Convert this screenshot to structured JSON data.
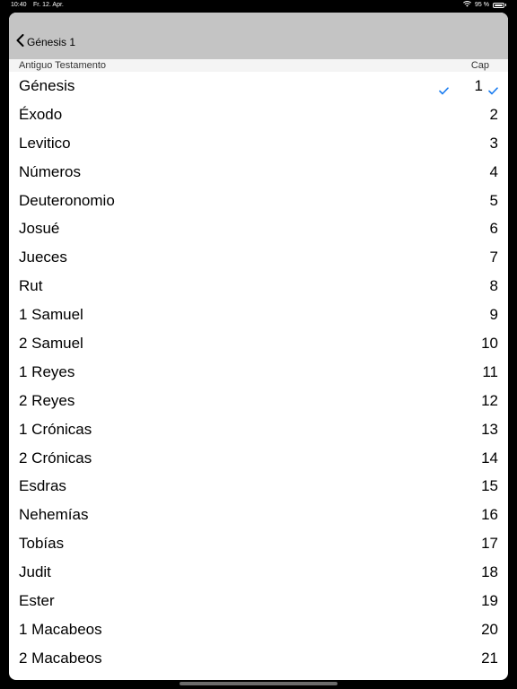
{
  "status": {
    "time": "10:40",
    "date": "Fr. 12. Apr.",
    "battery": "95 %",
    "battery_level": 0.95
  },
  "nav": {
    "back_label": "Génesis 1"
  },
  "section": {
    "title": "Antiguo Testamento",
    "column": "Cap"
  },
  "colors": {
    "accent": "#1a7cf0",
    "navbar": "#c4c4c4"
  },
  "rows": [
    {
      "book": "Génesis",
      "chapter": "1",
      "selected": true
    },
    {
      "book": "Éxodo",
      "chapter": "2"
    },
    {
      "book": "Levitico",
      "chapter": "3"
    },
    {
      "book": "Números",
      "chapter": "4"
    },
    {
      "book": "Deuteronomio",
      "chapter": "5"
    },
    {
      "book": "Josué",
      "chapter": "6"
    },
    {
      "book": "Jueces",
      "chapter": "7"
    },
    {
      "book": "Rut",
      "chapter": "8"
    },
    {
      "book": "1 Samuel",
      "chapter": "9"
    },
    {
      "book": "2 Samuel",
      "chapter": "10"
    },
    {
      "book": "1 Reyes",
      "chapter": "11"
    },
    {
      "book": "2 Reyes",
      "chapter": "12"
    },
    {
      "book": "1 Crónicas",
      "chapter": "13"
    },
    {
      "book": "2 Crónicas",
      "chapter": "14"
    },
    {
      "book": "Esdras",
      "chapter": "15"
    },
    {
      "book": "Nehemías",
      "chapter": "16"
    },
    {
      "book": "Tobías",
      "chapter": "17"
    },
    {
      "book": "Judit",
      "chapter": "18"
    },
    {
      "book": "Ester",
      "chapter": "19"
    },
    {
      "book": "1 Macabeos",
      "chapter": "20"
    },
    {
      "book": "2 Macabeos",
      "chapter": "21"
    }
  ]
}
